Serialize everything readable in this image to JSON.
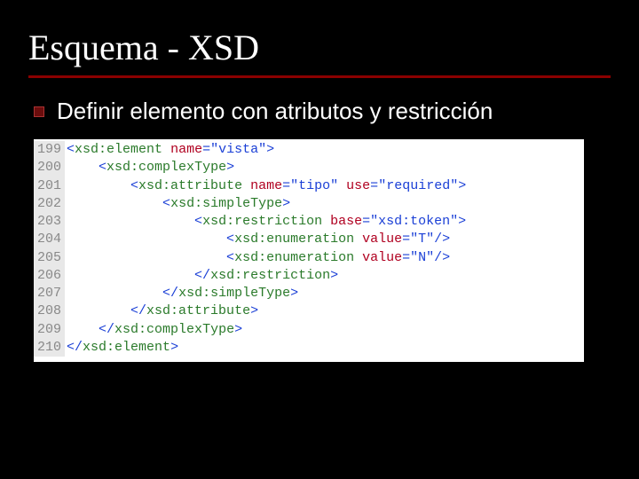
{
  "slide": {
    "title": "Esquema - XSD",
    "bullet": "Definir elemento con atributos y restricción"
  },
  "code": {
    "line_numbers": [
      "199",
      "200",
      "201",
      "202",
      "203",
      "204",
      "205",
      "206",
      "207",
      "208",
      "209",
      "210"
    ],
    "lines": [
      {
        "indent": 0,
        "tokens": [
          {
            "t": "punct",
            "v": "<"
          },
          {
            "t": "tag",
            "v": "xsd:element"
          },
          {
            "t": "plain",
            "v": " "
          },
          {
            "t": "attr",
            "v": "name"
          },
          {
            "t": "punct",
            "v": "="
          },
          {
            "t": "val",
            "v": "\"vista\""
          },
          {
            "t": "punct",
            "v": ">"
          }
        ]
      },
      {
        "indent": 1,
        "tokens": [
          {
            "t": "punct",
            "v": "<"
          },
          {
            "t": "tag",
            "v": "xsd:complexType"
          },
          {
            "t": "punct",
            "v": ">"
          }
        ]
      },
      {
        "indent": 2,
        "tokens": [
          {
            "t": "punct",
            "v": "<"
          },
          {
            "t": "tag",
            "v": "xsd:attribute"
          },
          {
            "t": "plain",
            "v": " "
          },
          {
            "t": "attr",
            "v": "name"
          },
          {
            "t": "punct",
            "v": "="
          },
          {
            "t": "val",
            "v": "\"tipo\""
          },
          {
            "t": "plain",
            "v": " "
          },
          {
            "t": "attr",
            "v": "use"
          },
          {
            "t": "punct",
            "v": "="
          },
          {
            "t": "val",
            "v": "\"required\""
          },
          {
            "t": "punct",
            "v": ">"
          }
        ]
      },
      {
        "indent": 3,
        "tokens": [
          {
            "t": "punct",
            "v": "<"
          },
          {
            "t": "tag",
            "v": "xsd:simpleType"
          },
          {
            "t": "punct",
            "v": ">"
          }
        ]
      },
      {
        "indent": 4,
        "tokens": [
          {
            "t": "punct",
            "v": "<"
          },
          {
            "t": "tag",
            "v": "xsd:restriction"
          },
          {
            "t": "plain",
            "v": " "
          },
          {
            "t": "attr",
            "v": "base"
          },
          {
            "t": "punct",
            "v": "="
          },
          {
            "t": "val",
            "v": "\"xsd:token\""
          },
          {
            "t": "punct",
            "v": ">"
          }
        ]
      },
      {
        "indent": 5,
        "tokens": [
          {
            "t": "punct",
            "v": "<"
          },
          {
            "t": "tag",
            "v": "xsd:enumeration"
          },
          {
            "t": "plain",
            "v": " "
          },
          {
            "t": "attr",
            "v": "value"
          },
          {
            "t": "punct",
            "v": "="
          },
          {
            "t": "val",
            "v": "\"T\""
          },
          {
            "t": "punct",
            "v": "/>"
          }
        ]
      },
      {
        "indent": 5,
        "tokens": [
          {
            "t": "punct",
            "v": "<"
          },
          {
            "t": "tag",
            "v": "xsd:enumeration"
          },
          {
            "t": "plain",
            "v": " "
          },
          {
            "t": "attr",
            "v": "value"
          },
          {
            "t": "punct",
            "v": "="
          },
          {
            "t": "val",
            "v": "\"N\""
          },
          {
            "t": "punct",
            "v": "/>"
          }
        ]
      },
      {
        "indent": 4,
        "tokens": [
          {
            "t": "punct",
            "v": "</"
          },
          {
            "t": "tag",
            "v": "xsd:restriction"
          },
          {
            "t": "punct",
            "v": ">"
          }
        ]
      },
      {
        "indent": 3,
        "tokens": [
          {
            "t": "punct",
            "v": "</"
          },
          {
            "t": "tag",
            "v": "xsd:simpleType"
          },
          {
            "t": "punct",
            "v": ">"
          }
        ]
      },
      {
        "indent": 2,
        "tokens": [
          {
            "t": "punct",
            "v": "</"
          },
          {
            "t": "tag",
            "v": "xsd:attribute"
          },
          {
            "t": "punct",
            "v": ">"
          }
        ]
      },
      {
        "indent": 1,
        "tokens": [
          {
            "t": "punct",
            "v": "</"
          },
          {
            "t": "tag",
            "v": "xsd:complexType"
          },
          {
            "t": "punct",
            "v": ">"
          }
        ]
      },
      {
        "indent": 0,
        "tokens": [
          {
            "t": "punct",
            "v": "</"
          },
          {
            "t": "tag",
            "v": "xsd:element"
          },
          {
            "t": "punct",
            "v": ">"
          }
        ]
      }
    ],
    "indent_unit": "    "
  }
}
